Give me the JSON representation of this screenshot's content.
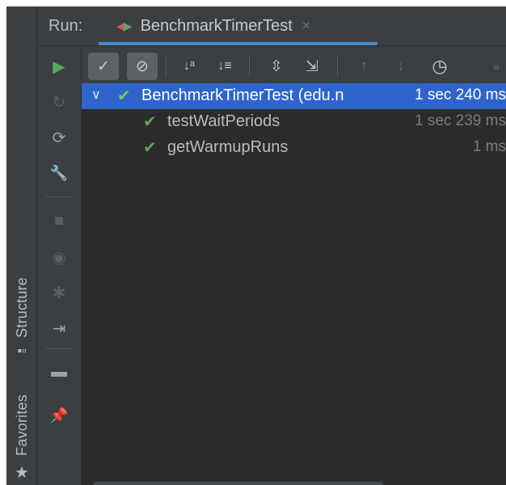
{
  "header": {
    "run_label": "Run:",
    "tab_title": "BenchmarkTimerTest",
    "tab_close": "×"
  },
  "left_strip": {
    "structure_label": "Structure",
    "favorites_label": "Favorites"
  },
  "icons": {
    "run": "▶",
    "rerun_failed": "↻",
    "toggle_auto": "⟳",
    "settings": "🔧",
    "stop": "■",
    "camera": "◉",
    "debug": "✱",
    "import": "⇥",
    "layout": "▬",
    "pin": "📌",
    "show_passed": "✓",
    "show_ignored": "⊘",
    "sort_alpha": "↓ᵃ",
    "sort_duration": "↓≡",
    "expand_all": "⇳",
    "collapse_all": "⇲",
    "prev": "↑",
    "next": "↓",
    "history": "◷",
    "more": "»",
    "chevron": "∨",
    "check": "✔"
  },
  "tree": {
    "root": {
      "name": "BenchmarkTimerTest (edu.n",
      "duration": "1 sec 240 ms"
    },
    "children": [
      {
        "name": "testWaitPeriods",
        "duration": "1 sec 239 ms"
      },
      {
        "name": "getWarmupRuns",
        "duration": "1 ms"
      }
    ]
  },
  "colors": {
    "selection": "#2f65ca",
    "success": "#5ea45a",
    "run_green": "#59a869",
    "tab_underline": "#4a88c7"
  }
}
